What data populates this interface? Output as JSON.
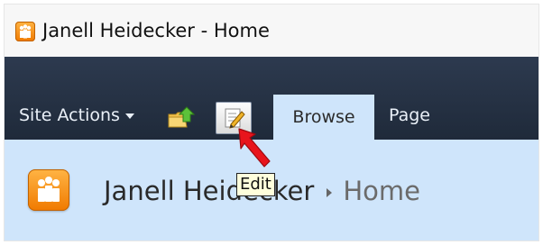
{
  "window": {
    "title": "Janell Heidecker - Home",
    "icon": "sharepoint-site-icon"
  },
  "ribbon": {
    "site_actions_label": "Site Actions",
    "navigate_up_icon": "navigate-up-icon",
    "edit_icon": "edit-page-icon",
    "tabs": [
      {
        "label": "Browse",
        "selected": true
      },
      {
        "label": "Page",
        "selected": false
      }
    ]
  },
  "breadcrumb": {
    "site": "Janell Heidecker",
    "page": "Home"
  },
  "tooltip": {
    "text": "Edit"
  },
  "annotation": {
    "arrow_color": "#e8141c"
  },
  "colors": {
    "ribbon_bg": "#24303f",
    "tab_selected_bg": "#cfe5fb",
    "content_bg": "#cfe5fb",
    "logo_orange": "#f58a0b"
  }
}
